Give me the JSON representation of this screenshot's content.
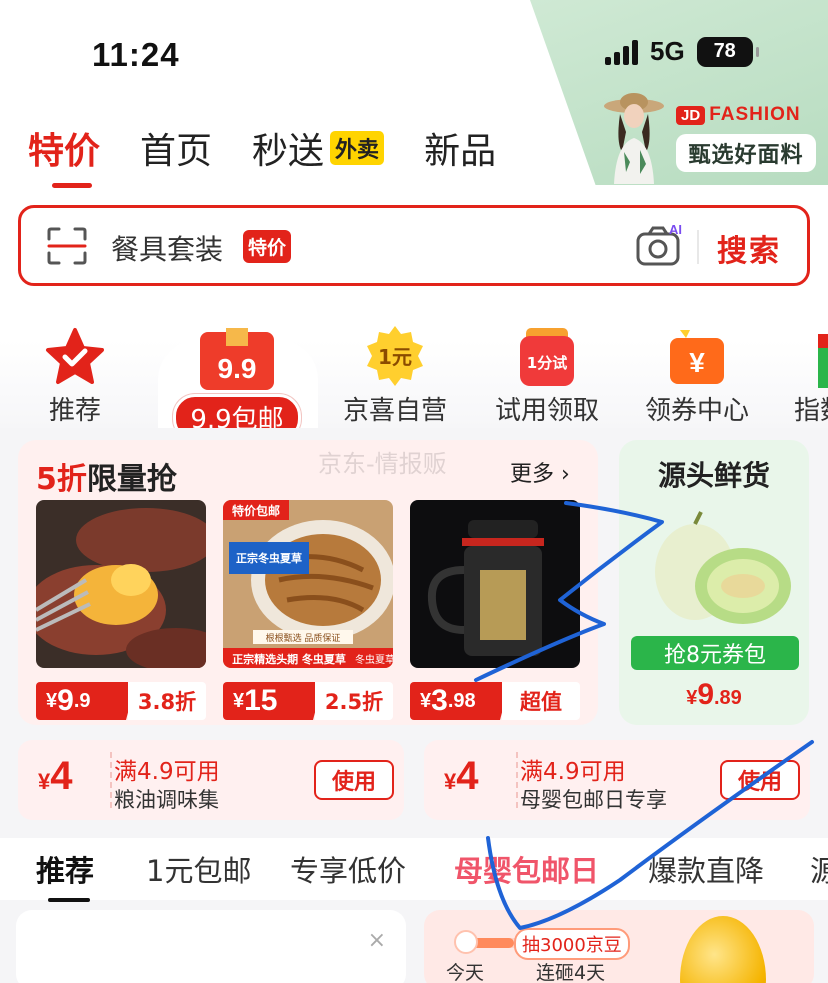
{
  "status_bar": {
    "time": "11:24",
    "network": "5G",
    "battery": "78"
  },
  "fashion_banner": {
    "brand_badge": "JD",
    "brand_word": "FASHION",
    "slogan": "甄选好面料"
  },
  "top_nav": {
    "tabs": [
      {
        "label": "特价",
        "active": true
      },
      {
        "label": "首页"
      },
      {
        "label": "秒送",
        "badge": "外卖"
      },
      {
        "label": "新品"
      }
    ]
  },
  "search": {
    "placeholder": "餐具套装",
    "tag": "特价",
    "ai_label": "AI",
    "button": "搜索"
  },
  "categories": [
    {
      "label": "推荐",
      "icon": "star-check-icon"
    },
    {
      "label": "9.9包邮",
      "icon_text": "9.9",
      "icon": "gift-box-icon",
      "active": true
    },
    {
      "label": "京喜自营",
      "icon_text": "1元",
      "icon": "coin-badge-icon"
    },
    {
      "label": "试用领取",
      "icon_text": "1分试",
      "icon": "red-bag-icon"
    },
    {
      "label": "领券中心",
      "icon_text": "¥",
      "icon": "coupon-icon"
    },
    {
      "label": "指数",
      "icon": "chart-icon"
    }
  ],
  "flash_sale": {
    "title_red": "5折",
    "title_rest": "限量抢",
    "watermark": "京东-情报贩",
    "more": "更多 ›",
    "products": [
      {
        "name": "烤红薯",
        "price_int": "9",
        "price_dec": ".9",
        "tag": "3.8折"
      },
      {
        "name": "冬虫夏草",
        "img_texts": [
          "特价包邮",
          "正宗冬虫夏草",
          "根根甄选 品质保证",
          "正宗精选头期 冬虫夏草",
          "冬虫夏草"
        ],
        "price_int": "15",
        "price_dec": "",
        "tag": "2.5折"
      },
      {
        "name": "泡茶杯",
        "price_int": "3",
        "price_dec": ".98",
        "tag": "超值"
      }
    ]
  },
  "fresh": {
    "title": "源头鲜货",
    "button": "抢8元券包",
    "price_int": "9",
    "price_dec": ".89"
  },
  "coupons": [
    {
      "amount": "4",
      "condition": "满4.9可用",
      "desc": "粮油调味集",
      "button": "使用"
    },
    {
      "amount": "4",
      "condition": "满4.9可用",
      "desc": "母婴包邮日专享",
      "button": "使用"
    }
  ],
  "currency": "¥",
  "feed_tabs": [
    {
      "label": "推荐",
      "active": true
    },
    {
      "label": "1元包邮"
    },
    {
      "label": "专享低价"
    },
    {
      "label": "母婴包邮日",
      "hot": true
    },
    {
      "label": "爆款直降"
    },
    {
      "label": "源"
    }
  ],
  "bottom_cards": {
    "close": "×",
    "lottery_badge": "抽3000京豆",
    "today": "今天",
    "streak": "连砸4天",
    "progress": 0.35
  },
  "colors": {
    "brand_red": "#e2231a",
    "green": "#2bb54a",
    "annotation_blue": "#1f63d6"
  }
}
